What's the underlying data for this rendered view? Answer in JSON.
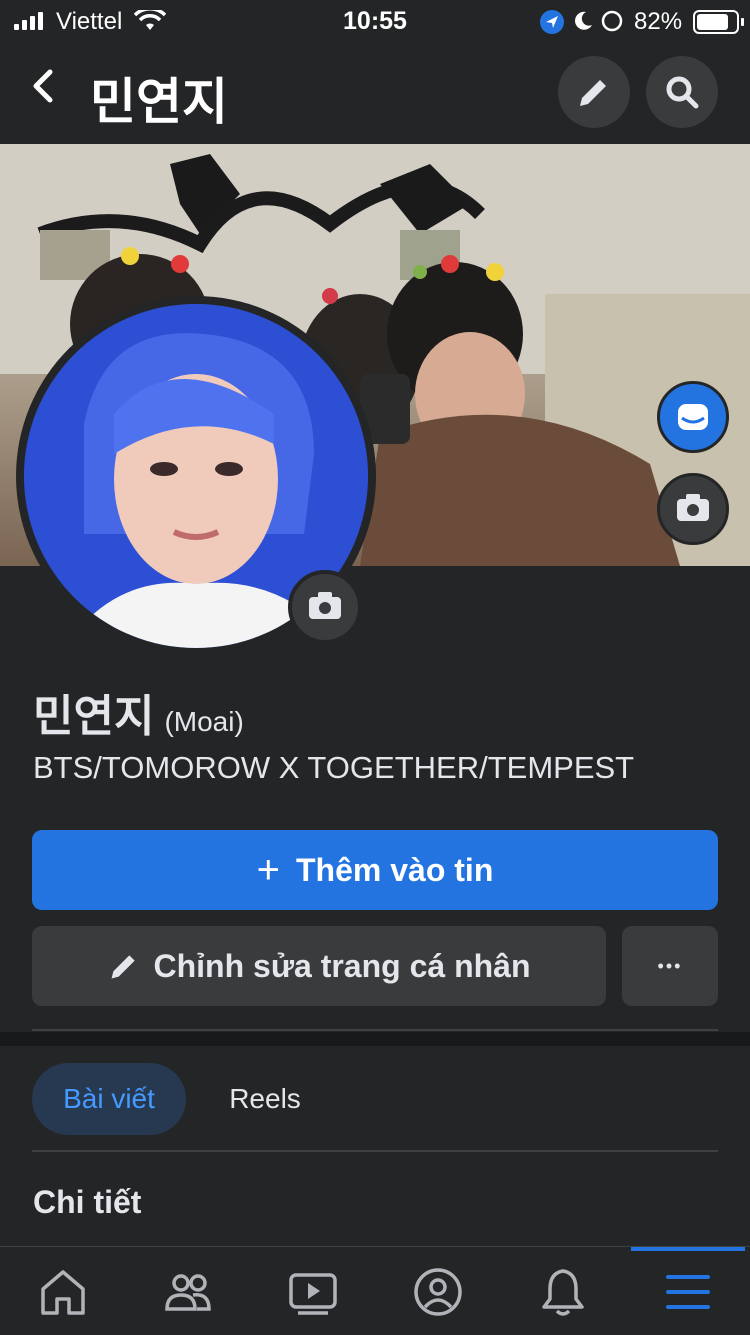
{
  "status_bar": {
    "carrier": "Viettel",
    "time": "10:55",
    "battery": "82%"
  },
  "header": {
    "title": "민연지"
  },
  "profile": {
    "name": "민연지",
    "alternate_name": "(Moai)",
    "bio": "BTS/TOMOROW X TOGETHER/TEMPEST"
  },
  "actions": {
    "add_story": "Thêm vào tin",
    "add_story_icon": "+",
    "edit_profile": "Chỉnh sửa trang cá nhân",
    "more": "•••"
  },
  "tabs": [
    {
      "label": "Bài viết",
      "active": true
    },
    {
      "label": "Reels",
      "active": false
    }
  ],
  "section": {
    "details_title": "Chi tiết"
  },
  "bottom_nav": {
    "items": [
      "home-icon",
      "friends-icon",
      "watch-icon",
      "profile-icon",
      "notifications-icon",
      "menu-icon"
    ],
    "active": "menu-icon"
  },
  "colors": {
    "accent": "#2374e1",
    "background": "#242526",
    "surface": "#3a3b3c",
    "tab_active_bg": "#263951"
  }
}
